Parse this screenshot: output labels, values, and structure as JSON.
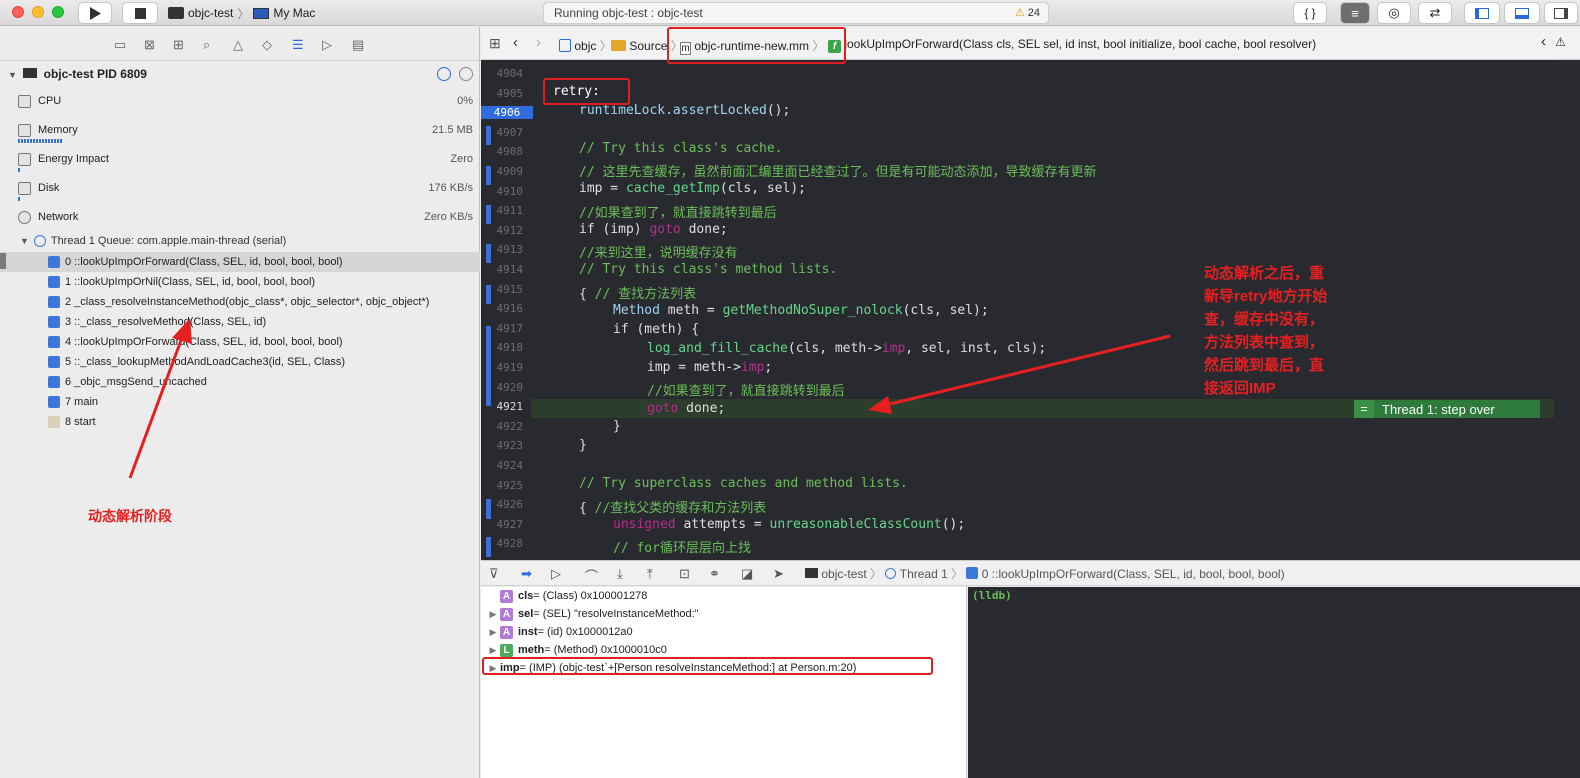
{
  "toolbar": {
    "scheme": "objc-test",
    "destination": "My Mac",
    "status": "Running objc-test : objc-test",
    "warnings": "24",
    "braces": "{ }"
  },
  "navigator": {
    "process": "objc-test PID 6809",
    "gauges": [
      {
        "label": "CPU",
        "value": "0%"
      },
      {
        "label": "Memory",
        "value": "21.5 MB"
      },
      {
        "label": "Energy Impact",
        "value": "Zero"
      },
      {
        "label": "Disk",
        "value": "176 KB/s"
      },
      {
        "label": "Network",
        "value": "Zero KB/s"
      }
    ],
    "thread": "Thread 1 Queue: com.apple.main-thread (serial)",
    "frames": [
      "0 ::lookUpImpOrForward(Class, SEL, id, bool, bool, bool)",
      "1 ::lookUpImpOrNil(Class, SEL, id, bool, bool, bool)",
      "2 _class_resolveInstanceMethod(objc_class*, objc_selector*, objc_object*)",
      "3 ::_class_resolveMethod(Class, SEL, id)",
      "4 ::lookUpImpOrForward(Class, SEL, id, bool, bool, bool)",
      "5 ::_class_lookupMethodAndLoadCache3(id, SEL, Class)",
      "6 _objc_msgSend_uncached",
      "7 main",
      "8 start"
    ]
  },
  "jumpbar": {
    "project": "objc",
    "folder": "Source",
    "file": "objc-runtime-new.mm",
    "file_badge": "m",
    "func_badge": "f",
    "function": "lookUpImpOrForward(Class cls, SEL sel, id inst, bool initialize, bool cache, bool resolver)"
  },
  "code": {
    "line_numbers": [
      "4904",
      "4905",
      "4906",
      "4907",
      "4908",
      "4909",
      "4910",
      "4911",
      "4912",
      "4913",
      "4914",
      "4915",
      "4916",
      "4917",
      "4918",
      "4919",
      "4920",
      "4921",
      "4922",
      "4923",
      "4924",
      "4925",
      "4926",
      "4927",
      "4928"
    ],
    "lines": {
      "l4905": "retry:",
      "l4906a": "runtimeLock.",
      "l4906b": "assertLocked",
      "l4906c": "();",
      "l4908": "// Try this class's cache.",
      "l4909": "// 这里先查缓存，虽然前面汇编里面已经查过了。但是有可能动态添加，导致缓存有更新",
      "l4910a": "imp = ",
      "l4910b": "cache_getImp",
      "l4910c": "(cls, sel);",
      "l4911": "//如果查到了，就直接跳转到最后",
      "l4912a": "if (imp) ",
      "l4912b": "goto",
      "l4912c": " done;",
      "l4913": "//来到这里，说明缓存没有",
      "l4914": "// Try this class's method lists.",
      "l4915a": "{ ",
      "l4915b": "// 查找方法列表",
      "l4916a": "Method",
      "l4916b": " meth = ",
      "l4916c": "getMethodNoSuper_nolock",
      "l4916d": "(cls, sel);",
      "l4917": "if (meth) {",
      "l4918a": "log_and_fill_cache",
      "l4918b": "(cls, meth->",
      "l4918c": "imp",
      "l4918d": ", sel, inst, cls);",
      "l4919a": "imp = meth->",
      "l4919b": "imp",
      "l4919c": ";",
      "l4920": "//如果查到了，就直接跳转到最后",
      "l4921a": "goto",
      "l4921b": " done;",
      "l4922": "}",
      "l4923": "}",
      "l4925": "// Try superclass caches and method lists.",
      "l4926a": "{ ",
      "l4926b": "//查找父类的缓存和方法列表",
      "l4927a": "unsigned",
      "l4927b": " attempts = ",
      "l4927c": "unreasonableClassCount",
      "l4927d": "();",
      "l4928": "// for循环层层向上找"
    },
    "step_badge": "=",
    "step_label": "Thread 1: step over"
  },
  "debugbar": {
    "target": "objc-test",
    "thread": "Thread 1",
    "frame": "0 ::lookUpImpOrForward(Class, SEL, id, bool, bool, bool)"
  },
  "variables": [
    {
      "badge": "A",
      "name": "cls",
      "rest": " = (Class) 0x100001278"
    },
    {
      "badge": "A",
      "name": "sel",
      "rest": " = (SEL) \"resolveInstanceMethod:\""
    },
    {
      "badge": "A",
      "name": "inst",
      "rest": " = (id) 0x1000012a0"
    },
    {
      "badge": "L",
      "name": "meth",
      "rest": " = (Method) 0x1000010c0"
    },
    {
      "badge": "",
      "name": "imp",
      "rest": " = (IMP) (objc-test`+[Person resolveInstanceMethod:] at Person.m:20)"
    }
  ],
  "console": {
    "prompt": "(lldb)"
  },
  "annotations": {
    "left": "动态解析阶段",
    "right": [
      "动态解析之后，重",
      "新导retry地方开始",
      "查，缓存中没有，",
      "方法列表中查到，",
      "然后跳到最后，直",
      "接返回IMP"
    ]
  },
  "colors": {
    "accent": "#2f6bdc",
    "annotation": "#e62020",
    "comment": "#6bbf59",
    "keyword": "#b52e8b",
    "step": "#2d7a3a"
  }
}
